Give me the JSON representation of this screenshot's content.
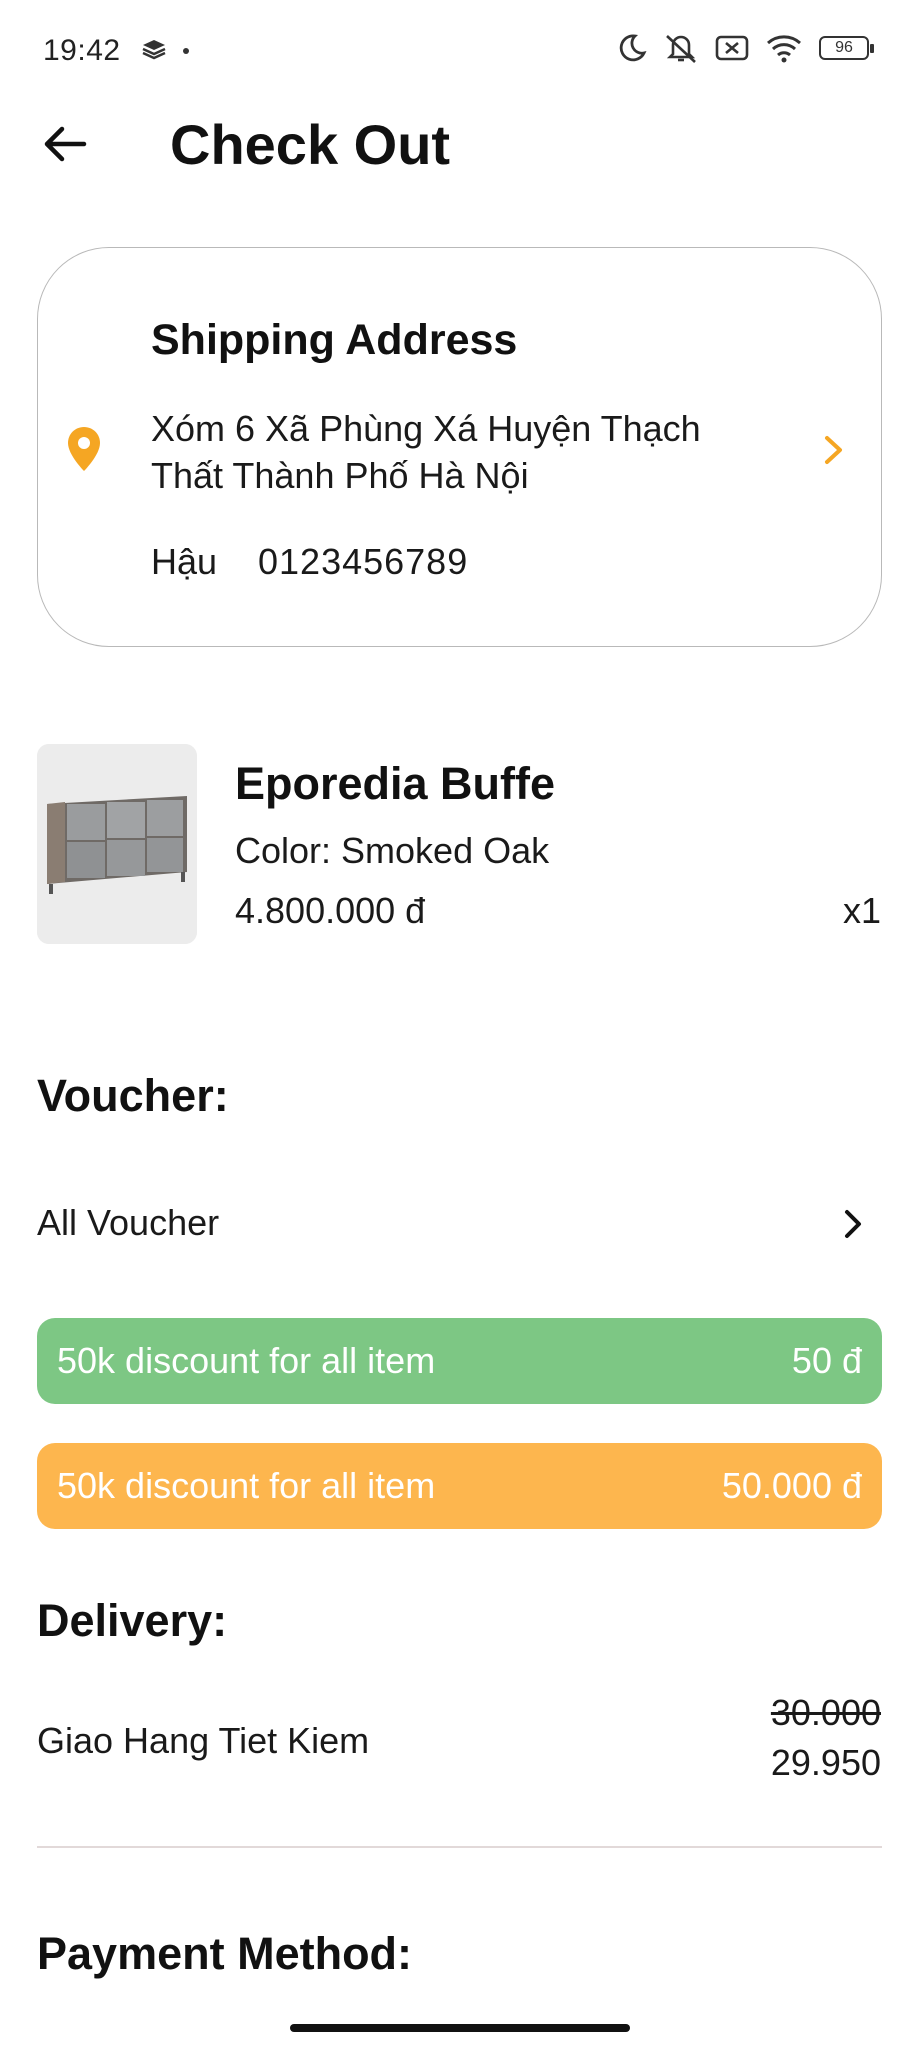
{
  "status_bar": {
    "time": "19:42",
    "battery": "96",
    "icons": [
      "layers-icon",
      "dot-icon",
      "moon-icon",
      "mute-icon",
      "no-sim-icon",
      "wifi-icon",
      "battery-icon"
    ]
  },
  "header": {
    "title": "Check Out",
    "back_icon": "arrow-left-icon"
  },
  "shipping": {
    "title": "Shipping Address",
    "address_line1": "Xóm 6 Xã Phùng Xá Huyện Thạch",
    "address_line2": "Thất Thành Phố Hà Nội",
    "name": "Hậu",
    "phone": "0123456789",
    "icon": "location-pin-icon",
    "accent": "#F5A623"
  },
  "product": {
    "name": "Eporedia Buffe",
    "color": "Color: Smoked Oak",
    "price": "4.800.000 đ",
    "quantity": "x1"
  },
  "voucher": {
    "title": "Voucher:",
    "all_label": "All Voucher",
    "items": [
      {
        "label": "50k discount for all item",
        "value": "50 đ",
        "color": "#7DC784"
      },
      {
        "label": "50k discount for all item",
        "value": "50.000 đ",
        "color": "#FDB64E"
      }
    ]
  },
  "delivery": {
    "title": "Delivery:",
    "method": "Giao Hang Tiet Kiem",
    "old_price": "30.000",
    "new_price": "29.950"
  },
  "payment": {
    "title": "Payment Method:"
  }
}
